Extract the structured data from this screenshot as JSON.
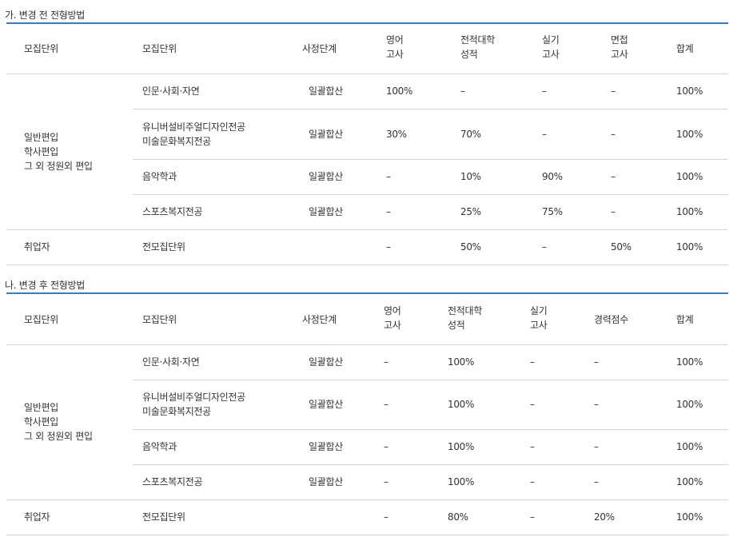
{
  "sections": [
    {
      "title": "가. 변경 전 전형방법",
      "headers": [
        "모집단위",
        "모집단위",
        "사정단계",
        [
          "영어",
          "고사"
        ],
        [
          "전적대학",
          "성적"
        ],
        [
          "실기",
          "고사"
        ],
        [
          "면접",
          "고사"
        ],
        "합계"
      ],
      "group_label": [
        "일반편입",
        "학사편입",
        "그 외 정원외 편입"
      ],
      "rows": [
        {
          "unit": [
            "인문·사회·자연"
          ],
          "stage": "일괄합산",
          "vals": [
            "100%",
            "–",
            "–",
            "–",
            "100%"
          ]
        },
        {
          "unit": [
            "유니버설비주얼디자인전공",
            "미술문화복지전공"
          ],
          "stage": "일괄합산",
          "vals": [
            "30%",
            "70%",
            "–",
            "–",
            "100%"
          ]
        },
        {
          "unit": [
            "음악학과"
          ],
          "stage": "일괄합산",
          "vals": [
            "–",
            "10%",
            "90%",
            "–",
            "100%"
          ]
        },
        {
          "unit": [
            "스포츠복지전공"
          ],
          "stage": "일괄합산",
          "vals": [
            "–",
            "25%",
            "75%",
            "–",
            "100%"
          ]
        }
      ],
      "last_row": {
        "group": "취업자",
        "unit": "전모집단위",
        "stage": "",
        "vals": [
          "–",
          "50%",
          "–",
          "50%",
          "100%"
        ]
      }
    },
    {
      "title": "나. 변경 후 전형방법",
      "headers": [
        "모집단위",
        "모집단위",
        "사정단계",
        [
          "영어",
          "고사"
        ],
        [
          "전적대학",
          "성적"
        ],
        [
          "실기",
          "고사"
        ],
        "경력점수",
        "합계"
      ],
      "group_label": [
        "일반편입",
        "학사편입",
        "그 외 정원외 편입"
      ],
      "rows": [
        {
          "unit": [
            "인문·사회·자연"
          ],
          "stage": "일괄합산",
          "vals": [
            "–",
            "100%",
            "–",
            "–",
            "100%"
          ]
        },
        {
          "unit": [
            "유니버설비주얼디자인전공",
            "미술문화복지전공"
          ],
          "stage": "일괄합산",
          "vals": [
            "–",
            "100%",
            "–",
            "–",
            "100%"
          ]
        },
        {
          "unit": [
            "음악학과"
          ],
          "stage": "일괄합산",
          "vals": [
            "–",
            "100%",
            "–",
            "–",
            "100%"
          ]
        },
        {
          "unit": [
            "스포츠복지전공"
          ],
          "stage": "일괄합산",
          "vals": [
            "–",
            "100%",
            "–",
            "–",
            "100%"
          ]
        }
      ],
      "last_row": {
        "group": "취업자",
        "unit": "전모집단위",
        "stage": "",
        "vals": [
          "–",
          "80%",
          "–",
          "20%",
          "100%"
        ]
      }
    }
  ]
}
